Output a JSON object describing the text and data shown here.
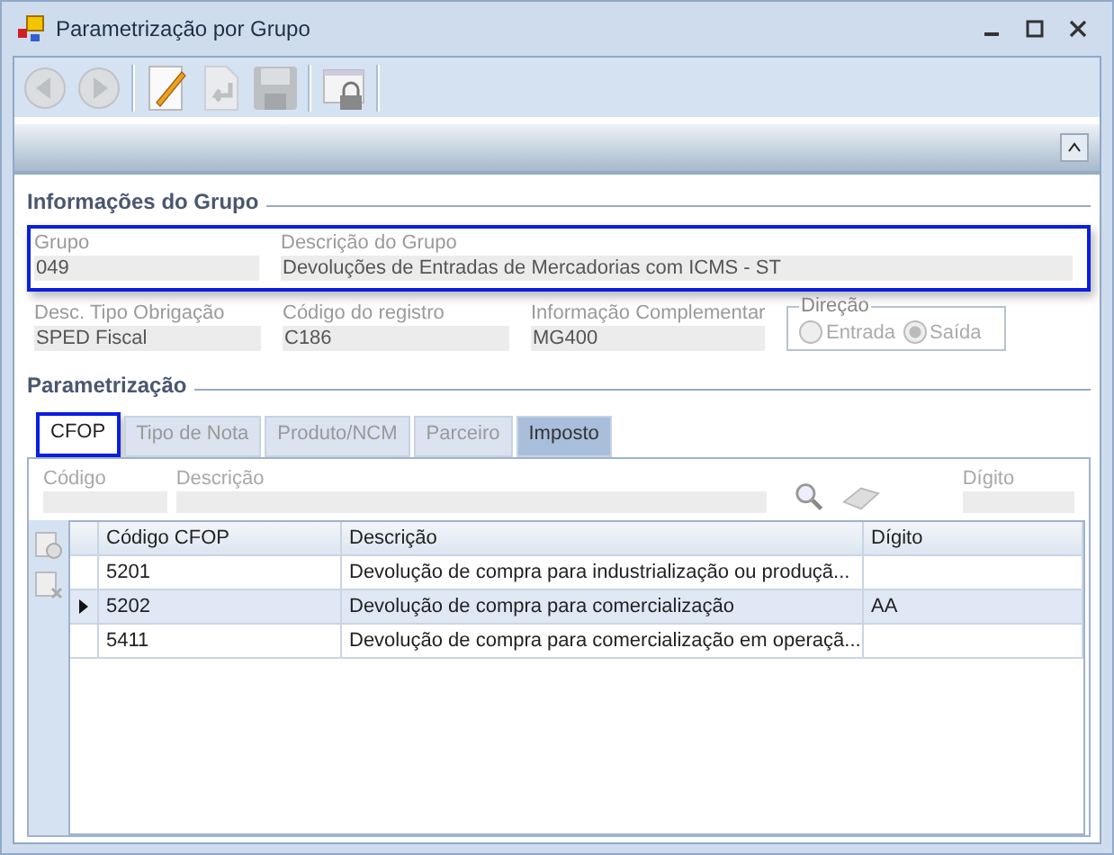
{
  "window": {
    "title": "Parametrização por Grupo"
  },
  "toolbar": [
    {
      "kind": "back",
      "disabled": true
    },
    {
      "kind": "forward",
      "disabled": true
    },
    {
      "kind": "edit",
      "disabled": false
    },
    {
      "kind": "undo",
      "disabled": true
    },
    {
      "kind": "save",
      "disabled": true
    },
    {
      "kind": "lock",
      "disabled": false
    }
  ],
  "group_info": {
    "title": "Informações do Grupo",
    "outlined_fields": [
      {
        "label": "Grupo",
        "value": "049"
      },
      {
        "label": "Descrição do Grupo",
        "value": "Devoluções de Entradas de Mercadorias com ICMS - ST"
      }
    ],
    "fields": [
      {
        "label": "Desc. Tipo Obrigação",
        "value": "SPED Fiscal"
      },
      {
        "label": "Código do registro",
        "value": "C186"
      },
      {
        "label": "Informação Complementar",
        "value": "MG400"
      }
    ],
    "direction": {
      "title": "Direção",
      "options": [
        {
          "label": "Entrada",
          "selected": false
        },
        {
          "label": "Saída",
          "selected": true
        }
      ]
    }
  },
  "parametrizacao": {
    "title": "Parametrização",
    "tabs": [
      {
        "label": "CFOP",
        "selected": true,
        "highlighted": true
      },
      {
        "label": "Tipo de Nota",
        "selected": false,
        "highlighted": false
      },
      {
        "label": "Produto/NCM",
        "selected": false,
        "highlighted": false
      },
      {
        "label": "Parceiro",
        "selected": false,
        "highlighted": false
      },
      {
        "label": "Imposto",
        "selected": false,
        "highlighted": false,
        "hovered": true
      }
    ],
    "filters": [
      {
        "label": "Código"
      },
      {
        "label": "Descrição"
      },
      {
        "label": "Dígito"
      }
    ],
    "table": {
      "columns": [
        "Código CFOP",
        "Descrição",
        "Dígito"
      ],
      "rows": [
        {
          "cells": [
            "5201",
            "Devolução de compra para industrialização ou produçã...",
            ""
          ],
          "selected": false
        },
        {
          "cells": [
            "5202",
            "Devolução de compra para comercialização",
            "AA"
          ],
          "selected": true
        },
        {
          "cells": [
            "5411",
            "Devolução de compra para comercialização em operaçã...",
            ""
          ],
          "selected": false
        }
      ]
    }
  }
}
